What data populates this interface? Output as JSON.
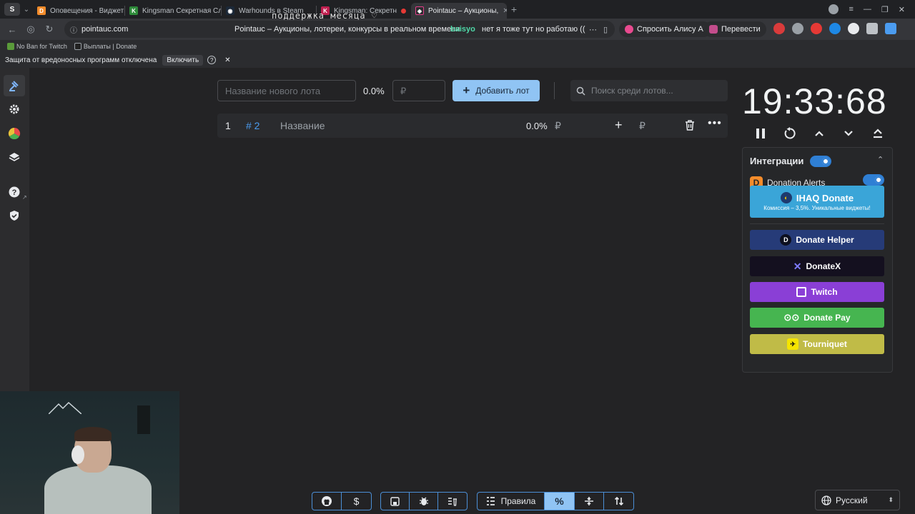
{
  "browser": {
    "tabs": [
      {
        "title": "Оповещения - Виджеты",
        "favicon": "donationalerts"
      },
      {
        "title": "Kingsman Секретная Слу",
        "favicon": "kg"
      },
      {
        "title": "Warhounds в Steam",
        "favicon": "steam"
      },
      {
        "title": "Kingsman: Секретн",
        "favicon": "k"
      },
      {
        "title": "Pointauc – Аукционы,",
        "favicon": "pointauc",
        "active": true
      }
    ],
    "address": {
      "url": "pointauc.com",
      "page_title": "Pointauc – Аукционы, лотереи, конкурсы в реальном времени",
      "overlay_text": "поддержка месяца  ♡",
      "chat_nick": "baisyo",
      "chat_message": "нет я тоже тут но работаю (("
    },
    "toolbar": {
      "alice": "Спросить Алису AI",
      "translate": "Перевести"
    },
    "bookmarks": [
      {
        "label": "No Ban for Twitch"
      },
      {
        "label": "Выплаты | Donate"
      }
    ],
    "infobar": {
      "message": "Защита от вредоносных программ отключена",
      "enable": "Включить"
    }
  },
  "app": {
    "new_lot_placeholder": "Название нового лота",
    "new_lot_percent": "0.0%",
    "amount_placeholder": "₽",
    "add_lot_label": "Добавить лот",
    "search_placeholder": "Поиск среди лотов...",
    "lots": [
      {
        "index": "1",
        "id": "# 2",
        "name": "Название",
        "percent": "0.0%",
        "currency": "₽",
        "currency2": "₽"
      }
    ],
    "timer": "19:33:68",
    "integrations": {
      "title": "Интеграции",
      "donation_alerts": "Donation Alerts",
      "ihaq": {
        "name": "IHAQ Donate",
        "subtitle": "Комиссия – 3,5%. Уникальные виджеты!"
      },
      "services": [
        {
          "name": "Donate Helper",
          "color": "#263b78"
        },
        {
          "name": "DonateX",
          "color": "#14101f"
        },
        {
          "name": "Twitch",
          "color": "#8a3fd6"
        },
        {
          "name": "Donate Pay",
          "color": "#46b550"
        },
        {
          "name": "Tourniquet",
          "color": "#c0bb47"
        }
      ]
    },
    "bottom": {
      "rules": "Правила",
      "percent_symbol": "%"
    },
    "language": "Русский"
  }
}
